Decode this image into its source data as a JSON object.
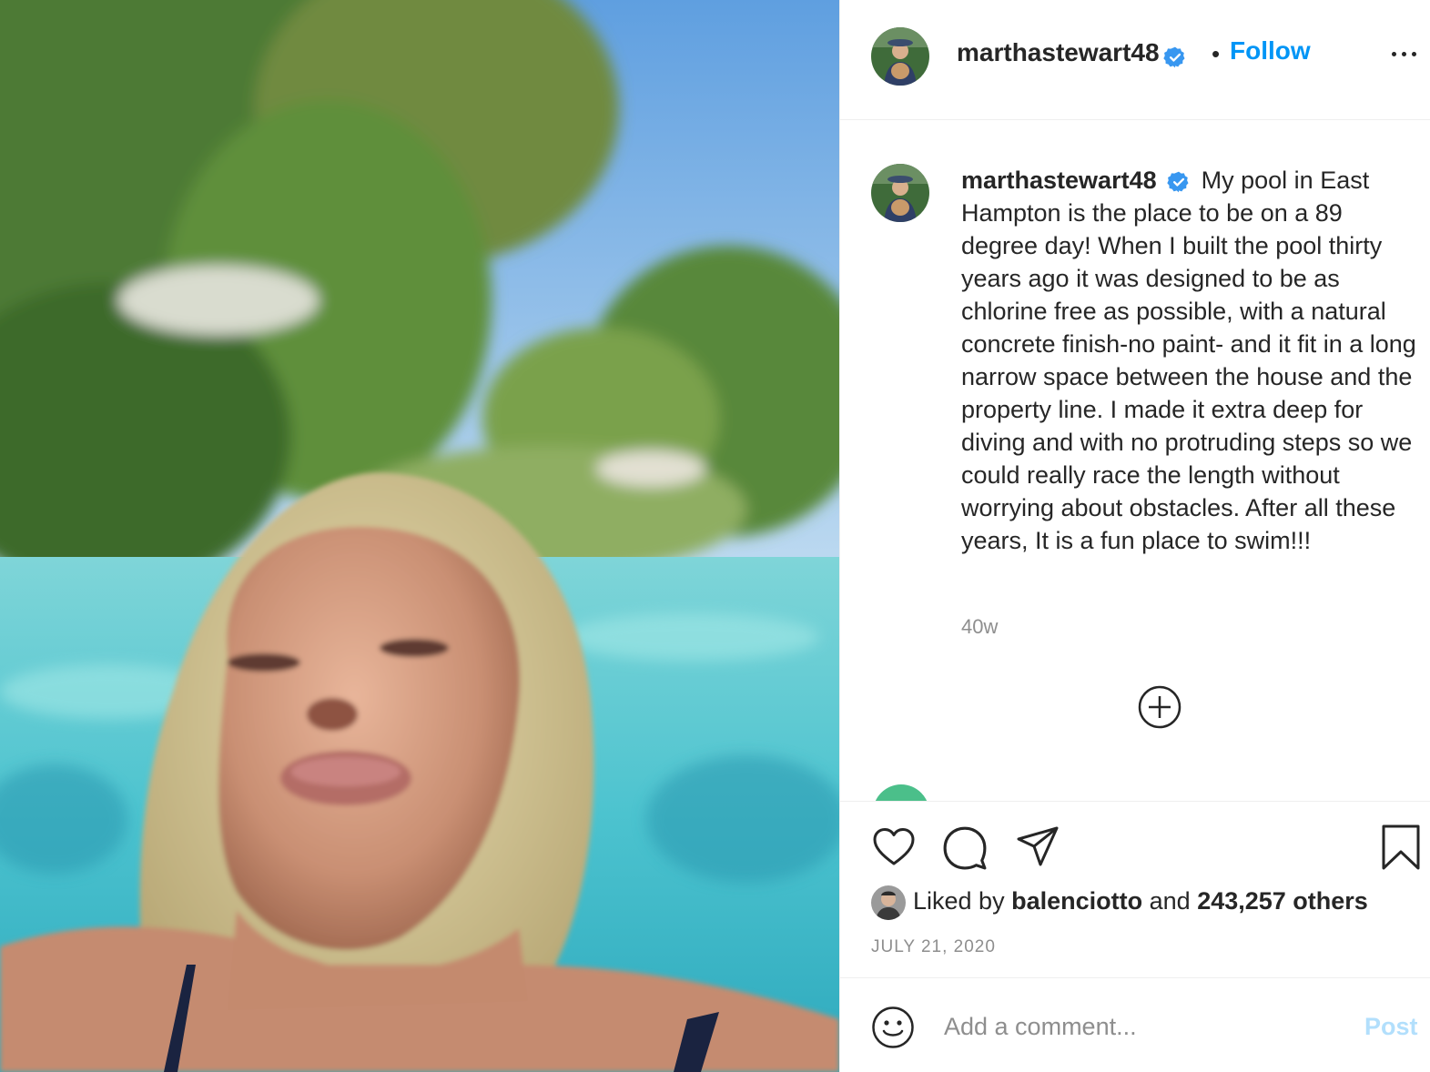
{
  "post": {
    "username": "marthastewart48",
    "follow_label": "Follow",
    "separator": "•",
    "caption": "My pool in East Hampton is the place to be on a 89 degree day! When I built the pool thirty years ago it was designed to be as chlorine free as possible, with a natural concrete finish-no paint- and it fit in a long narrow space between the house and the property line. I made it extra deep for diving and with no protruding steps so we could really race the length without worrying about obstacles. After all these years, It is a fun place to swim!!!",
    "time_ago": "40w"
  },
  "likes": {
    "prefix": "Liked by",
    "liker": "balenciotto",
    "conj": "and",
    "count": "243,257 others"
  },
  "date": "JULY 21, 2020",
  "comment": {
    "placeholder": "Add a comment...",
    "post_label": "Post"
  },
  "colors": {
    "accent": "#0095f6",
    "verified": "#3897f0",
    "post_disabled": "#b2dffc",
    "muted": "#8e8e8e"
  },
  "icons": [
    "heart-icon",
    "comment-icon",
    "share-icon",
    "bookmark-icon",
    "add-comment-icon",
    "emoji-icon",
    "verified-badge-icon",
    "more-options-icon"
  ]
}
